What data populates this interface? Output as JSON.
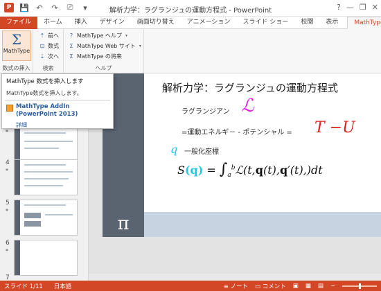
{
  "titlebar": {
    "app_icon": "P",
    "title": "解析力学：ラグランジュの運動方程式 - PowerPoint",
    "help": "?",
    "minimize": "—",
    "restore": "❐",
    "close": "✕"
  },
  "tabs": [
    "ファイル",
    "ホーム",
    "挿入",
    "デザイン",
    "画面切り替え",
    "アニメーション",
    "スライド ショー",
    "校閲",
    "表示",
    "MathType"
  ],
  "ribbon": {
    "insert_group": {
      "button_label": "MathType",
      "group_label": "数式の挿入"
    },
    "search_group": {
      "prev": "前へ",
      "equation": "数式",
      "next": "次へ",
      "group_label": "検索"
    },
    "help_group": {
      "help": "MathType ヘルプ",
      "web": "MathType Web サイト",
      "future": "MathType の将来",
      "group_label": "ヘルプ"
    }
  },
  "tooltip": {
    "title": "MathType 数式を挿入します",
    "description": "MathType数式を挿入します。",
    "addin_line1": "MathType AddIn",
    "addin_line2": "(PowerPoint 2013)",
    "more": "詳細"
  },
  "thumbnails": [
    {
      "num": "3",
      "star": "*"
    },
    {
      "num": "4",
      "star": "*"
    },
    {
      "num": "5",
      "star": "*"
    },
    {
      "num": "6",
      "star": "*"
    },
    {
      "num": "7",
      "star": ""
    }
  ],
  "slide": {
    "title": "解析力学：ラグランジュの運動方程式",
    "lagrangian_label": "ラグランジアン",
    "lagrangian_symbol": "ℒ",
    "energy_text": "=運動エネルギ－ - ポテンシャル =",
    "energy_formula": "T −U",
    "q_symbol": "q",
    "generalized_coords": "一般化座標",
    "pi_symbol": "π"
  },
  "status": {
    "slide": "スライド 1/11",
    "language": "日本語",
    "notes": "ノート",
    "comments": "コメント"
  },
  "colors": {
    "accent": "#d24726",
    "slide_dark": "#5a6470",
    "slide_light": "#c7d3e0",
    "magenta": "#e61ee6",
    "red": "#e02020",
    "cyan": "#20c8e0"
  }
}
